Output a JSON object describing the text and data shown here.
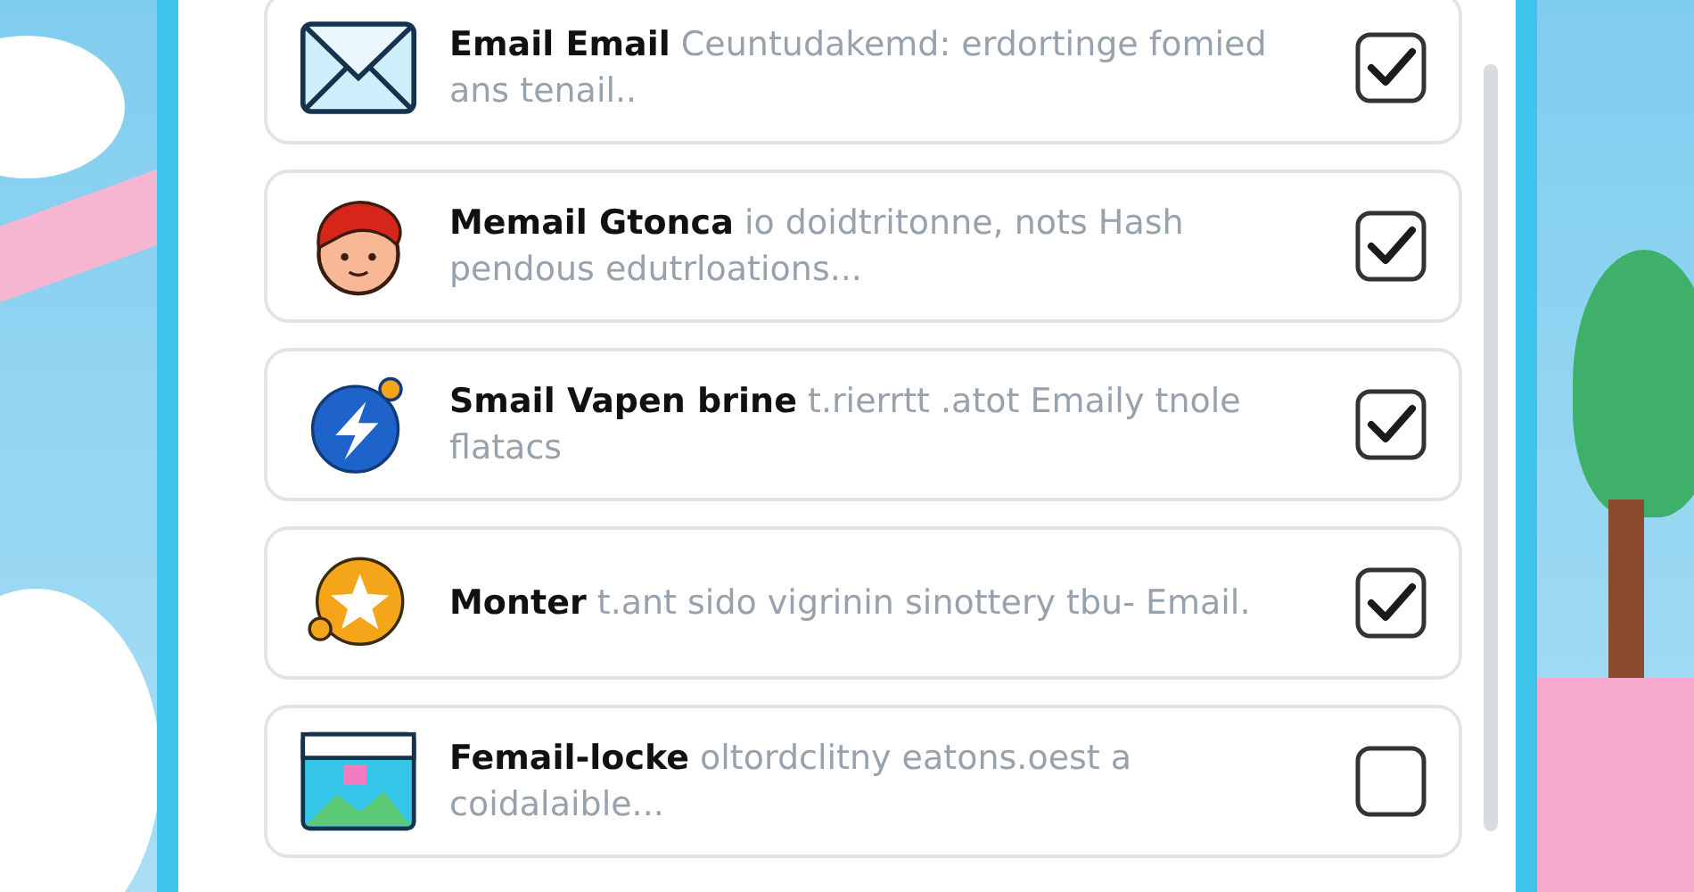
{
  "items": [
    {
      "kind": "envelope",
      "text": "**Email Email** Ceuntudakemd: erdortinge fomied ans tenail..",
      "checked": true
    },
    {
      "kind": "avatar",
      "text": "**Memail Gtonca** io doidtritonne, nots Hash pendous edutrloations...",
      "checked": true
    },
    {
      "kind": "bolt",
      "text": "**Smail Vapen brine** t.rierrtt .atot Emaily tnole flatacs",
      "checked": true
    },
    {
      "kind": "star",
      "text": "**Monter** t.ant sido vigrinin sinottery tbu- Email.",
      "checked": true
    },
    {
      "kind": "image",
      "text": "**Femail-locke** oltordclitny eatons.oest a coidalaible...",
      "checked": false
    }
  ]
}
